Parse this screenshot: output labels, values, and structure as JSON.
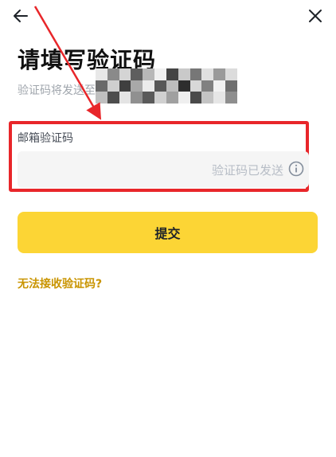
{
  "header": {
    "back_icon": "arrow-left-icon",
    "close_icon": "close-icon"
  },
  "page": {
    "title": "请填写验证码",
    "subtitle": "验证码将发送至"
  },
  "form": {
    "email_code": {
      "label": "邮箱验证码",
      "value": "",
      "status_text": "验证码已发送",
      "info_icon": "info-circle-icon"
    },
    "submit_label": "提交",
    "help_link": "无法接收验证码?"
  },
  "colors": {
    "accent": "#fcd535",
    "link": "#c99400",
    "highlight": "#e8262a",
    "input_bg": "#f5f5f5",
    "muted_text": "#a0a6ad"
  }
}
